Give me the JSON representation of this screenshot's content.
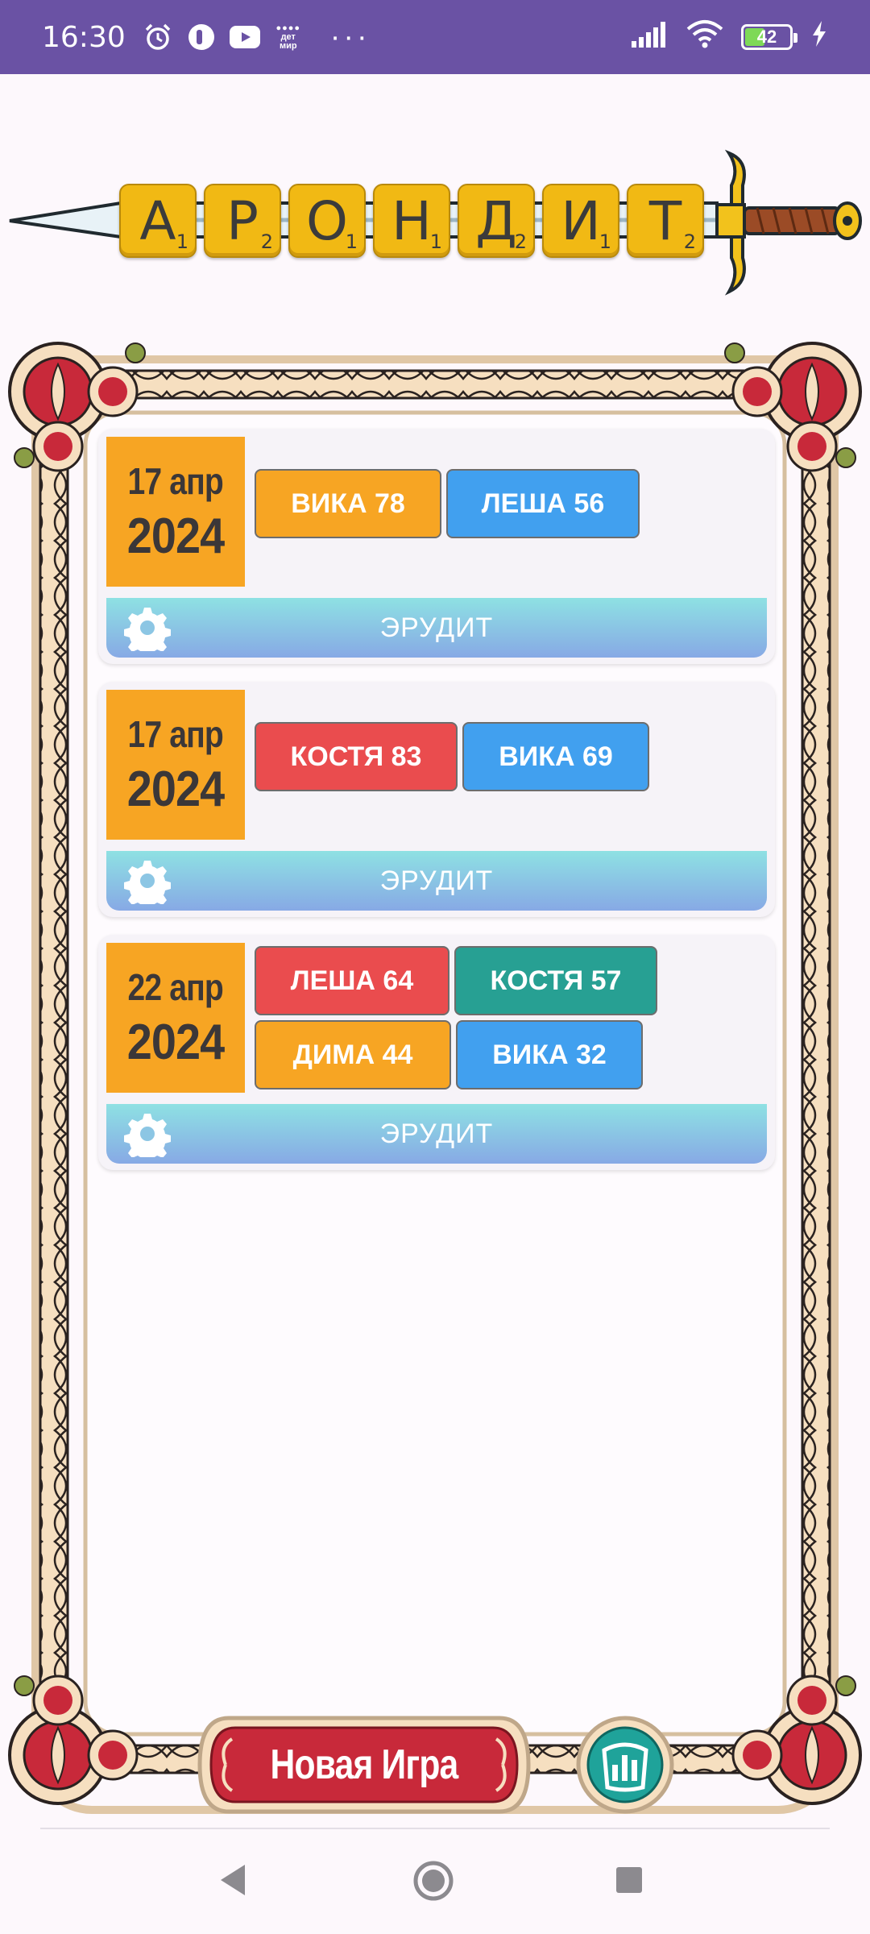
{
  "status_bar": {
    "time": "16:30",
    "icons": [
      "alarm-icon",
      "notification-app-icon",
      "youtube-icon",
      "detmir-icon",
      "more-icon",
      "signal-icon",
      "wifi-icon",
      "battery-icon",
      "charging-icon"
    ],
    "detmir_label": "дет мир",
    "more": "···",
    "battery_level": "42"
  },
  "logo": {
    "tiles": [
      {
        "letter": "А",
        "points": "1"
      },
      {
        "letter": "Р",
        "points": "2"
      },
      {
        "letter": "О",
        "points": "1"
      },
      {
        "letter": "Н",
        "points": "1"
      },
      {
        "letter": "Д",
        "points": "2"
      },
      {
        "letter": "И",
        "points": "1"
      },
      {
        "letter": "Т",
        "points": "2"
      }
    ]
  },
  "games": [
    {
      "date_day_month": "17 апр",
      "date_year": "2024",
      "players": [
        {
          "label": "ВИКА 78",
          "color": "orange"
        },
        {
          "label": "ЛЕША 56",
          "color": "blue"
        }
      ],
      "mode": "ЭРУДИТ"
    },
    {
      "date_day_month": "17 апр",
      "date_year": "2024",
      "players": [
        {
          "label": "КОСТЯ 83",
          "color": "red"
        },
        {
          "label": "ВИКА 69",
          "color": "blue"
        }
      ],
      "mode": "ЭРУДИТ"
    },
    {
      "date_day_month": "22 апр",
      "date_year": "2024",
      "players": [
        {
          "label": "ЛЕША 64",
          "color": "red"
        },
        {
          "label": "КОСТЯ 57",
          "color": "teal"
        },
        {
          "label": "ДИМА 44",
          "color": "orange"
        },
        {
          "label": "ВИКА 32",
          "color": "blue"
        }
      ],
      "mode": "ЭРУДИТ"
    }
  ],
  "buttons": {
    "new_game": "Новая Игра",
    "stats_icon": "bar-chart-icon"
  },
  "colors": {
    "status_bar": "#6a52a4",
    "tile": "#f1b914",
    "date_box": "#f7a523",
    "orange": "#f7a523",
    "blue": "#41a0ef",
    "red": "#ea4c4e",
    "teal": "#27a093",
    "new_game_button": "#c8293a",
    "stats_button": "#1fa39a"
  },
  "nav": {
    "back_icon": "back-triangle-icon",
    "home_icon": "home-circle-icon",
    "recents_icon": "recents-square-icon"
  }
}
